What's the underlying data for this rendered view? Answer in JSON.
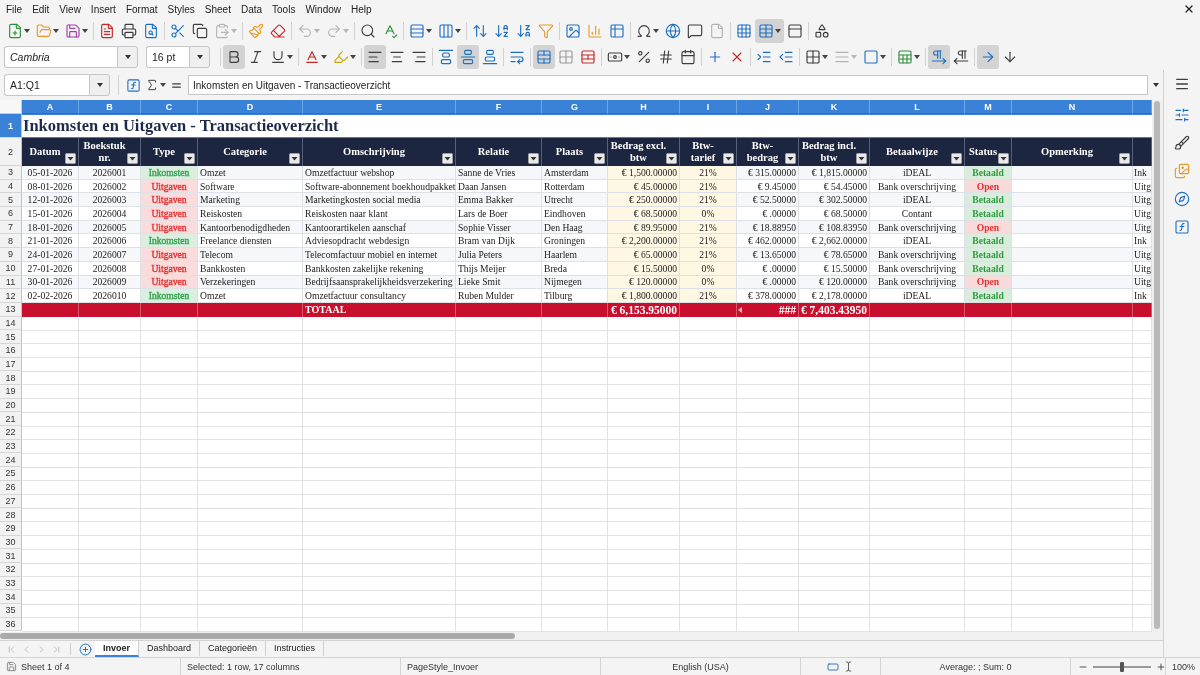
{
  "menu_bar": {
    "items": [
      "File",
      "Edit",
      "View",
      "Insert",
      "Format",
      "Styles",
      "Sheet",
      "Data",
      "Tools",
      "Window",
      "Help"
    ]
  },
  "standard_toolbar": {
    "groups": [
      [
        {
          "pressed": false,
          "disabled": false,
          "dropdown": true
        },
        {
          "pressed": false,
          "disabled": false,
          "dropdown": true
        },
        {
          "pressed": false,
          "disabled": false,
          "dropdown": true
        }
      ],
      [
        {
          "pressed": false,
          "disabled": false
        },
        {
          "pressed": false,
          "disabled": false
        },
        {
          "pressed": false,
          "disabled": false
        }
      ],
      [
        {
          "pressed": false,
          "disabled": false
        },
        {
          "pressed": false,
          "disabled": false
        },
        {
          "pressed": false,
          "disabled": true,
          "dropdown": true
        }
      ],
      [
        {
          "pressed": false,
          "disabled": false
        },
        {
          "pressed": false,
          "disabled": false
        }
      ],
      [
        {
          "pressed": false,
          "disabled": true,
          "dropdown": true
        },
        {
          "pressed": false,
          "disabled": true,
          "dropdown": true
        }
      ],
      [
        {
          "pressed": false,
          "disabled": false
        },
        {
          "pressed": false,
          "disabled": false
        }
      ],
      [
        {
          "pressed": false,
          "disabled": false,
          "dropdown": true
        },
        {
          "pressed": false,
          "disabled": false,
          "dropdown": true
        }
      ],
      [
        {
          "pressed": false,
          "disabled": false
        },
        {
          "pressed": false,
          "disabled": false
        },
        {
          "pressed": false,
          "disabled": false
        },
        {
          "pressed": false,
          "disabled": false
        }
      ],
      [
        {
          "pressed": false,
          "disabled": false
        },
        {
          "pressed": false,
          "disabled": false
        },
        {
          "pressed": false,
          "disabled": false
        }
      ],
      [
        {
          "pressed": false,
          "disabled": false,
          "dropdown": true
        },
        {
          "pressed": false,
          "disabled": false
        },
        {
          "pressed": false,
          "disabled": false
        },
        {
          "pressed": false,
          "disabled": true
        }
      ],
      [
        {
          "pressed": false,
          "disabled": false
        },
        {
          "pressed": true,
          "disabled": false,
          "dropdown": true
        },
        {
          "pressed": false,
          "disabled": false
        }
      ],
      [
        {
          "pressed": false,
          "disabled": false
        }
      ]
    ]
  },
  "formatting_toolbar": {
    "font_name": "Cambria",
    "font_size": "16 pt",
    "groups": [
      [
        {
          "pressed": true,
          "disabled": false
        },
        {
          "pressed": false,
          "disabled": false
        },
        {
          "pressed": false,
          "disabled": false,
          "dropdown": true
        }
      ],
      [
        {
          "pressed": false,
          "disabled": false,
          "dropdown": true
        },
        {
          "pressed": false,
          "disabled": false,
          "dropdown": true
        }
      ],
      [
        {
          "pressed": true,
          "disabled": false
        },
        {
          "pressed": false,
          "disabled": false
        },
        {
          "pressed": false,
          "disabled": false
        }
      ],
      [
        {
          "pressed": false,
          "disabled": false
        },
        {
          "pressed": true,
          "disabled": false
        },
        {
          "pressed": false,
          "disabled": false
        }
      ],
      [
        {
          "pressed": false,
          "disabled": false
        }
      ],
      [
        {
          "pressed": true,
          "disabled": false
        },
        {
          "pressed": false,
          "disabled": false
        },
        {
          "pressed": false,
          "disabled": false
        }
      ],
      [
        {
          "pressed": false,
          "disabled": false,
          "dropdown": true
        },
        {
          "pressed": false,
          "disabled": false
        },
        {
          "pressed": false,
          "disabled": false
        },
        {
          "pressed": false,
          "disabled": false
        }
      ],
      [
        {
          "pressed": false,
          "disabled": false
        },
        {
          "pressed": false,
          "disabled": false
        }
      ],
      [
        {
          "pressed": false,
          "disabled": false
        },
        {
          "pressed": false,
          "disabled": false
        }
      ],
      [
        {
          "pressed": false,
          "disabled": false,
          "dropdown": true
        },
        {
          "pressed": false,
          "disabled": true,
          "dropdown": true
        },
        {
          "pressed": false,
          "disabled": false,
          "dropdown": true
        }
      ],
      [
        {
          "pressed": false,
          "disabled": false,
          "dropdown": true
        }
      ],
      [
        {
          "pressed": true,
          "disabled": false
        },
        {
          "pressed": false,
          "disabled": false
        }
      ],
      [
        {
          "pressed": true,
          "disabled": false
        },
        {
          "pressed": false,
          "disabled": false
        }
      ]
    ]
  },
  "formula_bar": {
    "name_box": "A1:Q1",
    "content": "Inkomsten en Uitgaven - Transactieoverzicht"
  },
  "sheet": {
    "columns": [
      {
        "letter": "A",
        "selected": true
      },
      {
        "letter": "B",
        "selected": true
      },
      {
        "letter": "C",
        "selected": true
      },
      {
        "letter": "D",
        "selected": true
      },
      {
        "letter": "E",
        "selected": true
      },
      {
        "letter": "F",
        "selected": true
      },
      {
        "letter": "G",
        "selected": true
      },
      {
        "letter": "H",
        "selected": true
      },
      {
        "letter": "I",
        "selected": true
      },
      {
        "letter": "J",
        "selected": true
      },
      {
        "letter": "K",
        "selected": true
      },
      {
        "letter": "L",
        "selected": true
      },
      {
        "letter": "M",
        "selected": true
      },
      {
        "letter": "N",
        "selected": true
      },
      {
        "selected": true
      }
    ],
    "title_row": {
      "number": "1",
      "selected": true,
      "title": "Inkomsten en Uitgaven - Transactieoverzicht"
    },
    "header_row": {
      "number": "2",
      "selected": false,
      "headings": [
        "Datum",
        "Boekstuk nr.",
        "Type",
        "Categorie",
        "Omschrijving",
        "Relatie",
        "Plaats",
        "Bedrag excl. btw",
        "Btw-tarief",
        "Btw-bedrag",
        "Bedrag incl. btw",
        "Betaalwijze",
        "Status",
        "Opmerking"
      ]
    },
    "rows": [
      {
        "number": "3",
        "selected": false,
        "datum": "05-01-2026",
        "boekstuk_nr": "2026001",
        "type": {
          "text": "Inkomsten",
          "color": "#3aa655"
        },
        "categorie": "Omzet",
        "omschrijving": "Omzetfactuur webshop",
        "relatie": "Sanne de Vries",
        "plaats": "Amsterdam",
        "bedrag_excl_btw": "€ 1,500.00000",
        "btw_tarief": "21%",
        "btw_bedrag": "€ 315.00000",
        "bedrag_incl_btw": "€ 1,815.00000",
        "betaalwijze": "iDEAL",
        "status": {
          "text": "Betaald",
          "color": "#2f9a3f"
        },
        "column_o": "Ink"
      },
      {
        "number": "4",
        "selected": false,
        "datum": "08-01-2026",
        "boekstuk_nr": "2026002",
        "type": {
          "text": "Uitgaven",
          "color": "#e23b3b"
        },
        "categorie": "Software",
        "omschrijving": "Software-abonnement boekhoudpakket",
        "relatie": "Daan Jansen",
        "plaats": "Rotterdam",
        "bedrag_excl_btw": "€ 45.00000",
        "btw_tarief": "21%",
        "btw_bedrag": "€ 9.45000",
        "bedrag_incl_btw": "€ 54.45000",
        "betaalwijze": "Bank overschrijving",
        "status": {
          "text": "Open",
          "color": "#e03131"
        },
        "column_o": "Uitg"
      },
      {
        "number": "5",
        "selected": false,
        "datum": "12-01-2026",
        "boekstuk_nr": "2026003",
        "type": {
          "text": "Uitgaven",
          "color": "#e23b3b"
        },
        "categorie": "Marketing",
        "omschrijving": "Marketingkosten social media",
        "relatie": "Emma Bakker",
        "plaats": "Utrecht",
        "bedrag_excl_btw": "€ 250.00000",
        "btw_tarief": "21%",
        "btw_bedrag": "€ 52.50000",
        "bedrag_incl_btw": "€ 302.50000",
        "betaalwijze": "iDEAL",
        "status": {
          "text": "Betaald",
          "color": "#2f9a3f"
        },
        "column_o": "Uitg"
      },
      {
        "number": "6",
        "selected": false,
        "datum": "15-01-2026",
        "boekstuk_nr": "2026004",
        "type": {
          "text": "Uitgaven",
          "color": "#e23b3b"
        },
        "categorie": "Reiskosten",
        "omschrijving": "Reiskosten naar klant",
        "relatie": "Lars de Boer",
        "plaats": "Eindhoven",
        "bedrag_excl_btw": "€ 68.50000",
        "btw_tarief": "0%",
        "btw_bedrag": "€ .00000",
        "bedrag_incl_btw": "€ 68.50000",
        "betaalwijze": "Contant",
        "status": {
          "text": "Betaald",
          "color": "#2f9a3f"
        },
        "column_o": "Uitg"
      },
      {
        "number": "7",
        "selected": false,
        "datum": "18-01-2026",
        "boekstuk_nr": "2026005",
        "type": {
          "text": "Uitgaven",
          "color": "#e23b3b"
        },
        "categorie": "Kantoorbenodigdheden",
        "omschrijving": "Kantoorartikelen aanschaf",
        "relatie": "Sophie Visser",
        "plaats": "Den Haag",
        "bedrag_excl_btw": "€ 89.95000",
        "btw_tarief": "21%",
        "btw_bedrag": "€ 18.88950",
        "bedrag_incl_btw": "€ 108.83950",
        "betaalwijze": "Bank overschrijving",
        "status": {
          "text": "Open",
          "color": "#e03131"
        },
        "column_o": "Uitg"
      },
      {
        "number": "8",
        "selected": false,
        "datum": "21-01-2026",
        "boekstuk_nr": "2026006",
        "type": {
          "text": "Inkomsten",
          "color": "#3aa655"
        },
        "categorie": "Freelance diensten",
        "omschrijving": "Adviesopdracht webdesign",
        "relatie": "Bram van Dijk",
        "plaats": "Groningen",
        "bedrag_excl_btw": "€ 2,200.00000",
        "btw_tarief": "21%",
        "btw_bedrag": "€ 462.00000",
        "bedrag_incl_btw": "€ 2,662.00000",
        "betaalwijze": "iDEAL",
        "status": {
          "text": "Betaald",
          "color": "#2f9a3f"
        },
        "column_o": "Ink"
      },
      {
        "number": "9",
        "selected": false,
        "datum": "24-01-2026",
        "boekstuk_nr": "2026007",
        "type": {
          "text": "Uitgaven",
          "color": "#e23b3b"
        },
        "categorie": "Telecom",
        "omschrijving": "Telecomfactuur mobiel en internet",
        "relatie": "Julia Peters",
        "plaats": "Haarlem",
        "bedrag_excl_btw": "€ 65.00000",
        "btw_tarief": "21%",
        "btw_bedrag": "€ 13.65000",
        "bedrag_incl_btw": "€ 78.65000",
        "betaalwijze": "Bank overschrijving",
        "status": {
          "text": "Betaald",
          "color": "#2f9a3f"
        },
        "column_o": "Uitg"
      },
      {
        "number": "10",
        "selected": false,
        "datum": "27-01-2026",
        "boekstuk_nr": "2026008",
        "type": {
          "text": "Uitgaven",
          "color": "#e23b3b"
        },
        "categorie": "Bankkosten",
        "omschrijving": "Bankkosten zakelijke rekening",
        "relatie": "Thijs Meijer",
        "plaats": "Breda",
        "bedrag_excl_btw": "€ 15.50000",
        "btw_tarief": "0%",
        "btw_bedrag": "€ .00000",
        "bedrag_incl_btw": "€ 15.50000",
        "betaalwijze": "Bank overschrijving",
        "status": {
          "text": "Betaald",
          "color": "#2f9a3f"
        },
        "column_o": "Uitg"
      },
      {
        "number": "11",
        "selected": false,
        "datum": "30-01-2026",
        "boekstuk_nr": "2026009",
        "type": {
          "text": "Uitgaven",
          "color": "#e23b3b"
        },
        "categorie": "Verzekeringen",
        "omschrijving": "Bedrijfsaansprakelijkheidsverzekering",
        "relatie": "Lieke Smit",
        "plaats": "Nijmegen",
        "bedrag_excl_btw": "€ 120.00000",
        "btw_tarief": "0%",
        "btw_bedrag": "€ .00000",
        "bedrag_incl_btw": "€ 120.00000",
        "betaalwijze": "Bank overschrijving",
        "status": {
          "text": "Open",
          "color": "#e03131"
        },
        "column_o": "Uitg"
      },
      {
        "number": "12",
        "selected": false,
        "datum": "02-02-2026",
        "boekstuk_nr": "2026010",
        "type": {
          "text": "Inkomsten",
          "color": "#3aa655"
        },
        "categorie": "Omzet",
        "omschrijving": "Omzetfactuur consultancy",
        "relatie": "Ruben Mulder",
        "plaats": "Tilburg",
        "bedrag_excl_btw": "€ 1,800.00000",
        "btw_tarief": "21%",
        "btw_bedrag": "€ 378.00000",
        "bedrag_incl_btw": "€ 2,178.00000",
        "betaalwijze": "iDEAL",
        "status": {
          "text": "Betaald",
          "color": "#2f9a3f"
        },
        "column_o": "Ink"
      }
    ],
    "total_row": {
      "number": "13",
      "selected": false,
      "omschrijving": "TOTAAL",
      "bedrag_excl_btw": "€ 6,153.95000",
      "btw_bedrag": {
        "text": "###",
        "overflow": true
      },
      "bedrag_incl_btw": "€ 7,403.43950"
    },
    "empty_rows": [
      {
        "number": "14",
        "selected": false
      },
      {
        "number": "15",
        "selected": false
      },
      {
        "number": "16",
        "selected": false
      },
      {
        "number": "17",
        "selected": false
      },
      {
        "number": "18",
        "selected": false
      },
      {
        "number": "19",
        "selected": false
      },
      {
        "number": "20",
        "selected": false
      },
      {
        "number": "21",
        "selected": false
      },
      {
        "number": "22",
        "selected": false
      },
      {
        "number": "23",
        "selected": false
      },
      {
        "number": "24",
        "selected": false
      },
      {
        "number": "25",
        "selected": false
      },
      {
        "number": "26",
        "selected": false
      },
      {
        "number": "27",
        "selected": false
      },
      {
        "number": "28",
        "selected": false
      },
      {
        "number": "29",
        "selected": false
      },
      {
        "number": "30",
        "selected": false
      },
      {
        "number": "31",
        "selected": false
      },
      {
        "number": "32",
        "selected": false
      },
      {
        "number": "33",
        "selected": false
      },
      {
        "number": "34",
        "selected": false
      },
      {
        "number": "35",
        "selected": false
      },
      {
        "number": "36",
        "selected": false
      }
    ]
  },
  "sheet_tabs": {
    "navigation": [
      {
        "disabled": true
      },
      {
        "disabled": true
      },
      {
        "disabled": true
      },
      {
        "disabled": true
      }
    ],
    "tabs": [
      {
        "label": "Invoer",
        "selected": true
      },
      {
        "label": "Dashboard",
        "selected": false
      },
      {
        "label": "Categorieën",
        "selected": false
      },
      {
        "label": "Instructies",
        "selected": false
      }
    ]
  },
  "status_bar": {
    "sheet_position": "Sheet 1 of 4",
    "selection": "Selected: 1 row, 17 columns",
    "page_style": "PageStyle_Invoer",
    "language": "English (USA)",
    "statistics": "Average: ; Sum: 0",
    "zoom": {
      "level": 0.5,
      "reading": "100%"
    }
  }
}
